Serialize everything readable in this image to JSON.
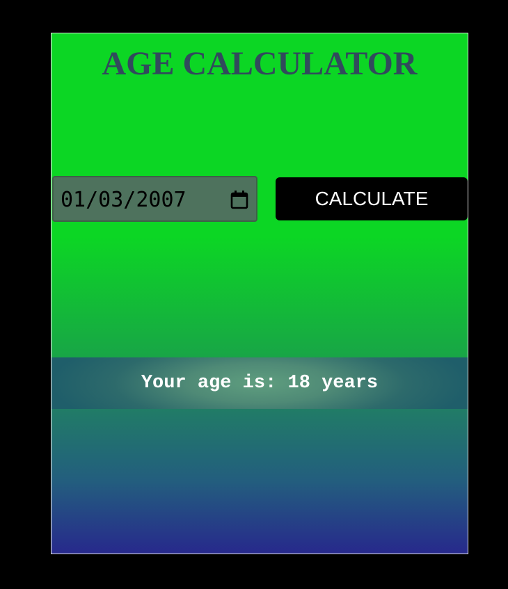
{
  "app": {
    "title": "AGE CALCULATOR"
  },
  "birthdate_input": {
    "value": "01/03/2007",
    "icon": "calendar-icon"
  },
  "calculate_button": {
    "label": "CALCULATE"
  },
  "result": {
    "text": "Your age is: 18 years"
  },
  "colors": {
    "page_background": "#000000",
    "card_top_green": "#0cd624",
    "card_bottom_blue": "#27298c",
    "title_color": "#314a5c",
    "button_background": "#000000",
    "button_text": "#ffffff",
    "result_text": "#ffffff"
  }
}
